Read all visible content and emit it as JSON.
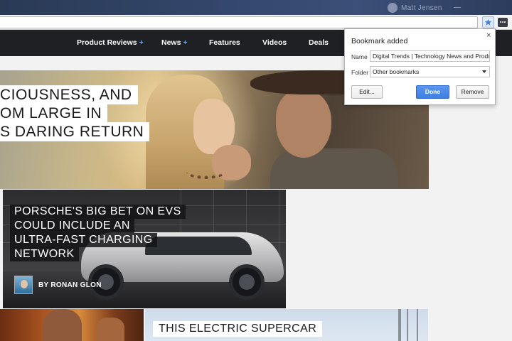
{
  "browser": {
    "profile_name": "Matt Jensen"
  },
  "nav": {
    "items": [
      {
        "label": "Product Reviews",
        "plus": "+"
      },
      {
        "label": "News",
        "plus": "+"
      },
      {
        "label": "Features"
      },
      {
        "label": "Videos"
      },
      {
        "label": "Deals"
      }
    ]
  },
  "hero": {
    "headline_lines": [
      "CIOUSNESS, AND",
      "OM LARGE IN",
      "S DARING RETURN"
    ]
  },
  "articles": {
    "porsche": {
      "title_lines": [
        "PORSCHE'S BIG BET ON EVS",
        "COULD INCLUDE AN",
        "ULTRA-FAST CHARGING",
        "NETWORK"
      ],
      "author": "BY RONAN GLON"
    },
    "ev_supercar": {
      "title": "THIS ELECTRIC SUPERCAR"
    }
  },
  "bookmark_popup": {
    "title": "Bookmark added",
    "close_glyph": "×",
    "name_label": "Name",
    "name_value": "Digital Trends | Technology News and Product",
    "folder_label": "Folder",
    "folder_value": "Other bookmarks",
    "edit_label": "Edit...",
    "done_label": "Done",
    "remove_label": "Remove"
  },
  "icons": {
    "bookmark_star": "star-icon",
    "menu": "menu-icon"
  },
  "colors": {
    "star_active": "#4a7fd4",
    "done_button": "#4a86e8",
    "nav_plus": "#5aa9ff",
    "site_nav_bg": "#1f2023"
  }
}
